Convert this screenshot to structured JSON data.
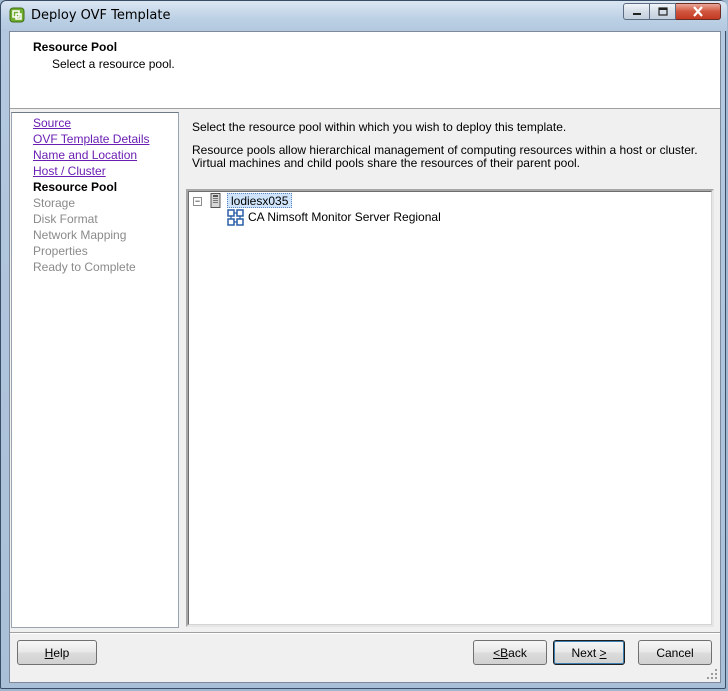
{
  "window": {
    "title": "Deploy OVF Template",
    "icons": {
      "app": "vsphere-deploy-icon",
      "minimize": "minimize-icon",
      "maximize": "maximize-icon",
      "close": "close-icon"
    }
  },
  "header": {
    "title": "Resource Pool",
    "subtitle": "Select a resource pool."
  },
  "nav": {
    "items": [
      {
        "label": "Source",
        "state": "link"
      },
      {
        "label": "OVF Template Details",
        "state": "link"
      },
      {
        "label": "Name and Location",
        "state": "link"
      },
      {
        "label": "Host / Cluster",
        "state": "link"
      },
      {
        "label": "Resource Pool",
        "state": "current"
      },
      {
        "label": "Storage",
        "state": "disabled"
      },
      {
        "label": "Disk Format",
        "state": "disabled"
      },
      {
        "label": "Network Mapping",
        "state": "disabled"
      },
      {
        "label": "Properties",
        "state": "disabled"
      },
      {
        "label": "Ready to Complete",
        "state": "disabled"
      }
    ]
  },
  "main": {
    "instruction": "Select the resource pool within which you wish to deploy this template.",
    "description": "Resource pools allow hierarchical management of computing resources within a host or cluster. Virtual machines and child pools share the resources of their parent pool.",
    "tree": {
      "expander": "−",
      "host": {
        "label": "lodiesx035",
        "icon": "host-server-icon",
        "selected": true
      },
      "children": [
        {
          "label": "CA Nimsoft Monitor Server Regional",
          "icon": "resource-pool-icon"
        }
      ]
    }
  },
  "footer": {
    "help": {
      "mnemonic": "H",
      "rest": "elp"
    },
    "back": {
      "prefix": "< ",
      "mnemonic": "B",
      "rest": "ack"
    },
    "next": {
      "text": "Next ",
      "mnemonic": ">"
    },
    "cancel": "Cancel"
  },
  "colors": {
    "link": "#6a1fb3",
    "disabled": "#8a8a8a",
    "selection": "#cfe4fb",
    "dialog_bg": "#f0f0f0"
  }
}
